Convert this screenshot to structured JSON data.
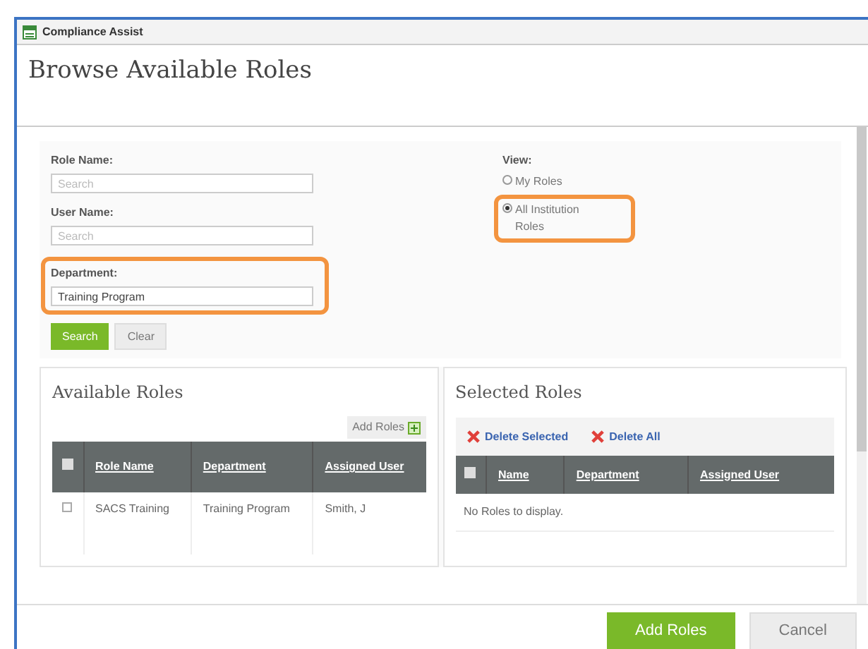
{
  "window": {
    "title": "Compliance Assist"
  },
  "heading": "Browse Available Roles",
  "form": {
    "fields": [
      {
        "label": "Role Name:",
        "placeholder": "Search",
        "highlighted": false
      },
      {
        "label": "User Name:",
        "placeholder": "Search",
        "highlighted": false
      },
      {
        "label": "Department:",
        "value": "Training Program",
        "highlighted": true
      }
    ],
    "buttons": [
      {
        "label": "Search",
        "kind": "primary"
      },
      {
        "label": "Clear",
        "kind": "secondary"
      }
    ],
    "view": {
      "label": "View:",
      "options": [
        {
          "label": "My Roles",
          "selected": false,
          "highlighted": false
        },
        {
          "label": "All Institution Roles",
          "selected": true,
          "highlighted": true
        }
      ]
    }
  },
  "available": {
    "title": "Available Roles",
    "add_button": "Add Roles",
    "all_checked": false,
    "columns": [
      "Role Name",
      "Department",
      "Assigned User"
    ],
    "rows": [
      {
        "checked": false,
        "cells": [
          "SACS Training",
          "Training Program",
          "Smith, J"
        ]
      }
    ]
  },
  "selected": {
    "title": "Selected Roles",
    "all_checked": false,
    "actions": [
      "Delete Selected",
      "Delete All"
    ],
    "columns": [
      "Name",
      "Department",
      "Assigned User"
    ],
    "empty": "No Roles to display."
  },
  "footer": {
    "buttons": [
      {
        "label": "Add Roles",
        "kind": "primary"
      },
      {
        "label": "Cancel",
        "kind": "secondary"
      }
    ]
  }
}
